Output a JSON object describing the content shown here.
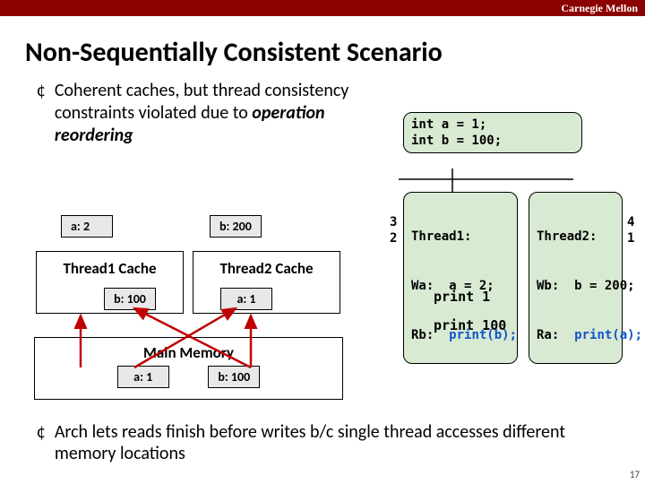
{
  "brand": "Carnegie Mellon",
  "title": "Non-Sequentially Consistent Scenario",
  "bullet1_a": "Coherent caches, but thread consistency constraints violated due to ",
  "bullet1_em": "operation reordering",
  "init_code": "int a = 1;\nint b = 100;",
  "t1": {
    "name": "Thread1:",
    "l1a": "Wa:  a = 2;",
    "l2a": "Rb:  ",
    "l2b": "print(b);"
  },
  "t2": {
    "name": "Thread2:",
    "l1a": "Wb:  b = 200;",
    "l2a": "Ra:  ",
    "l2b": "print(a);"
  },
  "seq": {
    "t1wa": "3",
    "t1rb": "2",
    "t2wb": "4",
    "t2ra": "1"
  },
  "reg_a": "a: 2",
  "reg_b": "b: 200",
  "cache1_label": "Thread1 Cache",
  "cache2_label": "Thread2 Cache",
  "cache1_v": "b: 100",
  "cache2_v": "a: 1",
  "print1": "print 1",
  "print2": "print 100",
  "mem_label": "Main Memory",
  "mem_a": "a: 1",
  "mem_b": "b: 100",
  "bullet2": "Arch lets reads finish before writes b/c single thread accesses different memory locations",
  "pagenum": "17"
}
